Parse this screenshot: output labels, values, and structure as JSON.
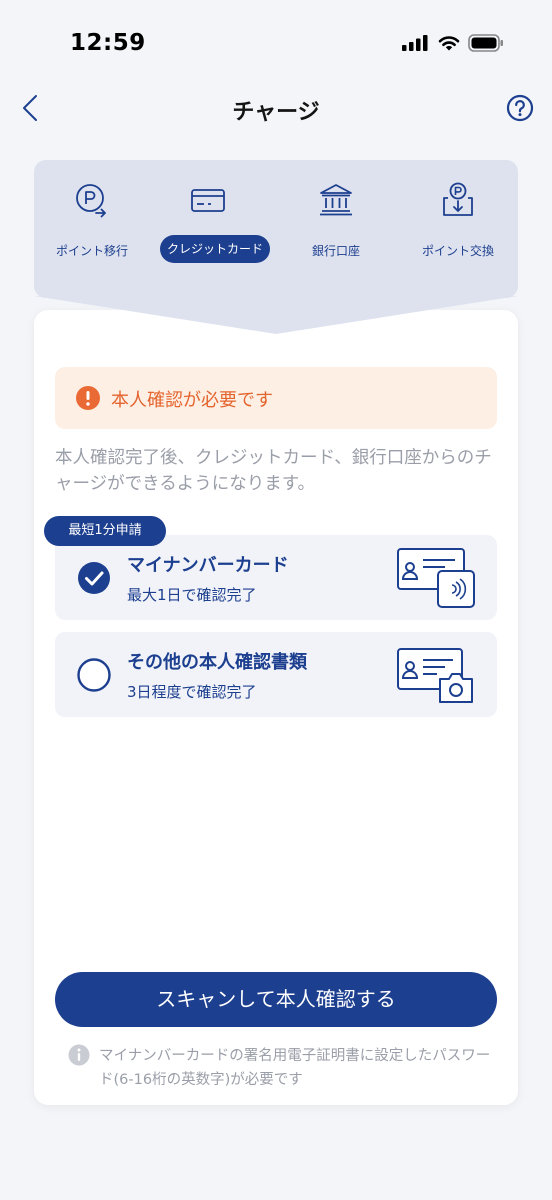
{
  "status_bar": {
    "time": "12:59",
    "icons": [
      "cellular-signal-icon",
      "wifi-icon",
      "battery-icon"
    ]
  },
  "nav": {
    "title": "チャージ",
    "back_icon": "chevron-left-icon",
    "help_icon": "question-circle-icon"
  },
  "tabs": [
    {
      "label": "ポイント移行",
      "icon": "point-transfer-icon",
      "active": false
    },
    {
      "label": "クレジットカード",
      "icon": "credit-card-icon",
      "active": true
    },
    {
      "label": "銀行口座",
      "icon": "bank-icon",
      "active": false
    },
    {
      "label": "ポイント交換",
      "icon": "point-exchange-icon",
      "active": false
    }
  ],
  "alert": {
    "icon": "exclamation-circle-icon",
    "text": "本人確認が必要です"
  },
  "description": "本人確認完了後、クレジットカード、銀行口座からのチャージができるようになります。",
  "badge": "最短1分申請",
  "options": [
    {
      "title": "マイナンバーカード",
      "subtitle": "最大1日で確認完了",
      "selected": true,
      "icon": "my-number-card-icon"
    },
    {
      "title": "その他の本人確認書類",
      "subtitle": "3日程度で確認完了",
      "selected": false,
      "icon": "id-document-camera-icon"
    }
  ],
  "scan_button": "スキャンして本人確認する",
  "note": {
    "icon": "info-circle-icon",
    "text": "マイナンバーカードの署名用電子証明書に設定したパスワード(6-16桁の英数字)が必要です"
  },
  "colors": {
    "primary": "#1d3f8f",
    "alert_text": "#e4642e",
    "alert_bg": "#fdefe4",
    "tab_panel_bg": "#dde2ee",
    "muted_text": "#9a9ea8"
  }
}
